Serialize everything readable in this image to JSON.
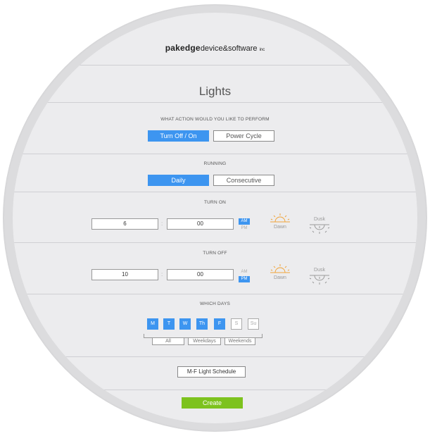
{
  "brand": {
    "bold": "pakedge",
    "rest": "device&software",
    "suffix": "inc"
  },
  "page_title": "Lights",
  "action": {
    "label": "WHAT ACTION WOULD YOU LIKE TO PERFORM",
    "options": [
      "Turn Off / On",
      "Power Cycle"
    ],
    "selected": "Turn Off / On"
  },
  "running": {
    "label": "RUNNING",
    "options": [
      "Daily",
      "Consecutive"
    ],
    "selected": "Daily"
  },
  "turn_on": {
    "label": "TURN ON",
    "hour": "6",
    "minute": "00",
    "separator": ":",
    "am": "AM",
    "pm": "PM",
    "selected_period": "AM",
    "dawn": "Dawn",
    "dusk": "Dusk"
  },
  "turn_off": {
    "label": "TURN OFF",
    "hour": "10",
    "minute": "00",
    "separator": ":",
    "am": "AM",
    "pm": "PM",
    "selected_period": "PM",
    "dawn": "Dawn",
    "dusk": "Dusk"
  },
  "days": {
    "label": "WHICH DAYS",
    "items": [
      {
        "label": "M",
        "selected": true
      },
      {
        "label": "T",
        "selected": true
      },
      {
        "label": "W",
        "selected": true
      },
      {
        "label": "Th",
        "selected": true
      },
      {
        "label": "F",
        "selected": true
      },
      {
        "label": "S",
        "selected": false
      },
      {
        "label": "Su",
        "selected": false
      }
    ],
    "groups": [
      "All",
      "Weekdays",
      "Weekends"
    ]
  },
  "schedule_name": "M-F Light Schedule",
  "create_label": "Create",
  "colors": {
    "accent": "#3d95f0",
    "create": "#7dc21e",
    "dawn": "#f0a43a",
    "dusk": "#9a9a9a"
  }
}
